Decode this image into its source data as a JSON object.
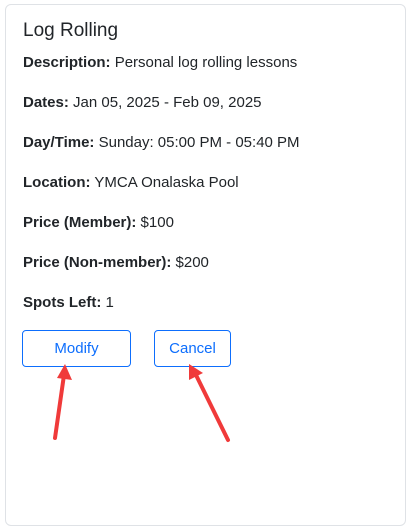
{
  "card": {
    "title": "Log Rolling",
    "fields": [
      {
        "label": "Description:",
        "value": "Personal log rolling lessons"
      },
      {
        "label": "Dates:",
        "value": "Jan 05, 2025 - Feb 09, 2025"
      },
      {
        "label": "Day/Time:",
        "value": "Sunday: 05:00 PM - 05:40 PM"
      },
      {
        "label": "Location:",
        "value": "YMCA Onalaska Pool"
      },
      {
        "label": "Price (Member):",
        "value": "$100"
      },
      {
        "label": "Price (Non-member):",
        "value": "$200"
      },
      {
        "label": "Spots Left:",
        "value": "1"
      }
    ],
    "buttons": {
      "modify_label": "Modify",
      "cancel_label": "Cancel"
    }
  },
  "colors": {
    "primary": "#0d6efd",
    "annotation_arrow": "#f03a3a",
    "card_border": "#dfe2e6"
  },
  "annotations": {
    "arrows": [
      "modify-arrow",
      "cancel-arrow"
    ]
  }
}
